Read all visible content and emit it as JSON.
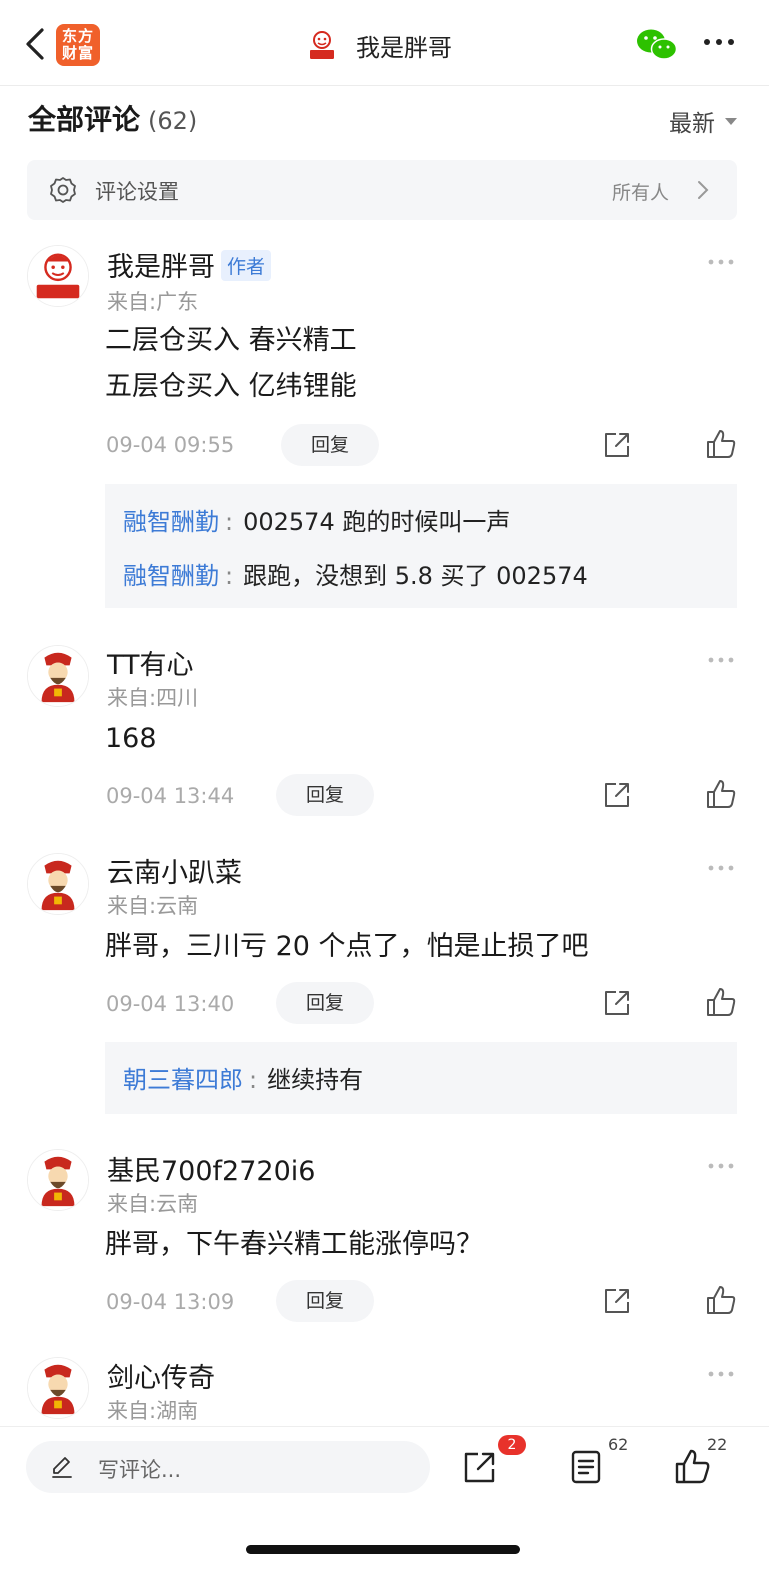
{
  "nav": {
    "app_logo_text": "东方财富",
    "title": "我是胖哥"
  },
  "header": {
    "title": "全部评论",
    "count": "(62)",
    "sort_label": "最新"
  },
  "settings": {
    "label": "评论设置",
    "value": "所有人"
  },
  "comments": [
    {
      "name": "我是胖哥",
      "tag": "作者",
      "location": "来自:广东",
      "lines": [
        "二层仓买入 春兴精工",
        "五层仓买入 亿纬锂能"
      ],
      "time": "09-04 09:55",
      "reply_label": "回复",
      "replies": [
        {
          "user": "融智酬勤",
          "colon": ":",
          "text": "002574 跑的时候叫一声"
        },
        {
          "user": "融智酬勤",
          "colon": ":",
          "text": "跟跑，没想到 5.8 买了 002574"
        }
      ]
    },
    {
      "name": "TT有心",
      "location": "来自:四川",
      "lines": [
        "168"
      ],
      "time": "09-04 13:44",
      "reply_label": "回复"
    },
    {
      "name": "云南小趴菜",
      "location": "来自:云南",
      "lines": [
        "胖哥，三川亏 20 个点了，怕是止损了吧"
      ],
      "time": "09-04 13:40",
      "reply_label": "回复",
      "replies": [
        {
          "user": "朝三暮四郎",
          "colon": ":",
          "text": "继续持有"
        }
      ]
    },
    {
      "name": "基民700f2720i6",
      "location": "来自:云南",
      "lines": [
        "胖哥，下午春兴精工能涨停吗？"
      ],
      "time": "09-04 13:09",
      "reply_label": "回复"
    },
    {
      "name": "剑心传奇",
      "location": "来自:湖南"
    }
  ],
  "bottom": {
    "placeholder": "写评论...",
    "share_badge": "2",
    "comment_count": "62",
    "like_count": "22"
  },
  "colors": {
    "accent_blue": "#3d7bd6",
    "brand_orange": "#f0602b",
    "badge_red": "#e8322b",
    "wechat_green": "#2dc100"
  }
}
